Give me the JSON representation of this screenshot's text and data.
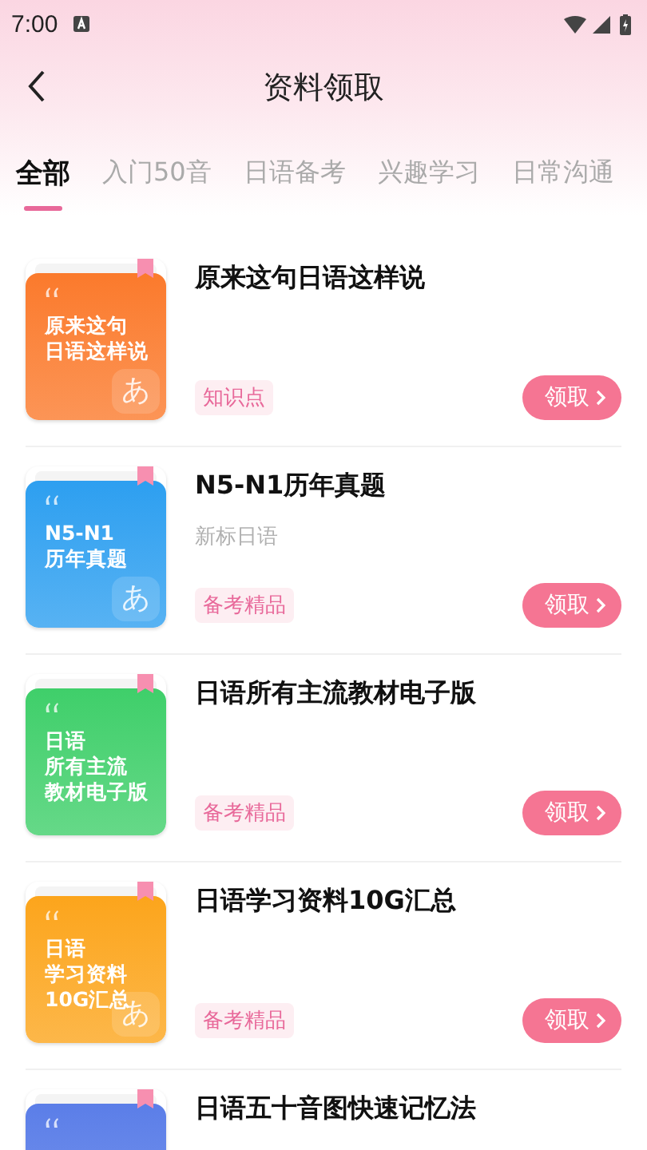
{
  "status_bar": {
    "time": "7:00"
  },
  "header": {
    "title": "资料领取"
  },
  "tabs": [
    {
      "label": "全部",
      "selected": true
    },
    {
      "label": "入门50音",
      "selected": false
    },
    {
      "label": "日语备考",
      "selected": false
    },
    {
      "label": "兴趣学习",
      "selected": false
    },
    {
      "label": "日常沟通",
      "selected": false
    }
  ],
  "items": [
    {
      "title": "原来这句日语这样说",
      "cover": {
        "color": "#fb7a2c",
        "lines": [
          "原来这句",
          "日语这样说"
        ],
        "kana": "あ"
      },
      "tag": "知识点",
      "button": "领取"
    },
    {
      "title": "N5-N1历年真题",
      "subtitle": "新标日语",
      "cover": {
        "color": "#2d9ff0",
        "lines": [
          "N5-N1",
          "历年真题"
        ],
        "kana": "あ"
      },
      "tag": "备考精品",
      "button": "领取"
    },
    {
      "title": "日语所有主流教材电子版",
      "cover": {
        "color": "#3fcf6a",
        "lines": [
          "日语",
          "所有主流",
          "教材电子版"
        ]
      },
      "tag": "备考精品",
      "button": "领取"
    },
    {
      "title": "日语学习资料10G汇总",
      "cover": {
        "color": "#fca51c",
        "lines": [
          "日语",
          "学习资料",
          "10G汇总"
        ],
        "kana": "あ"
      },
      "tag": "备考精品",
      "button": "领取"
    },
    {
      "title": "日语五十音图快速记忆法",
      "cover": {
        "color": "#5b7ee8"
      }
    }
  ]
}
